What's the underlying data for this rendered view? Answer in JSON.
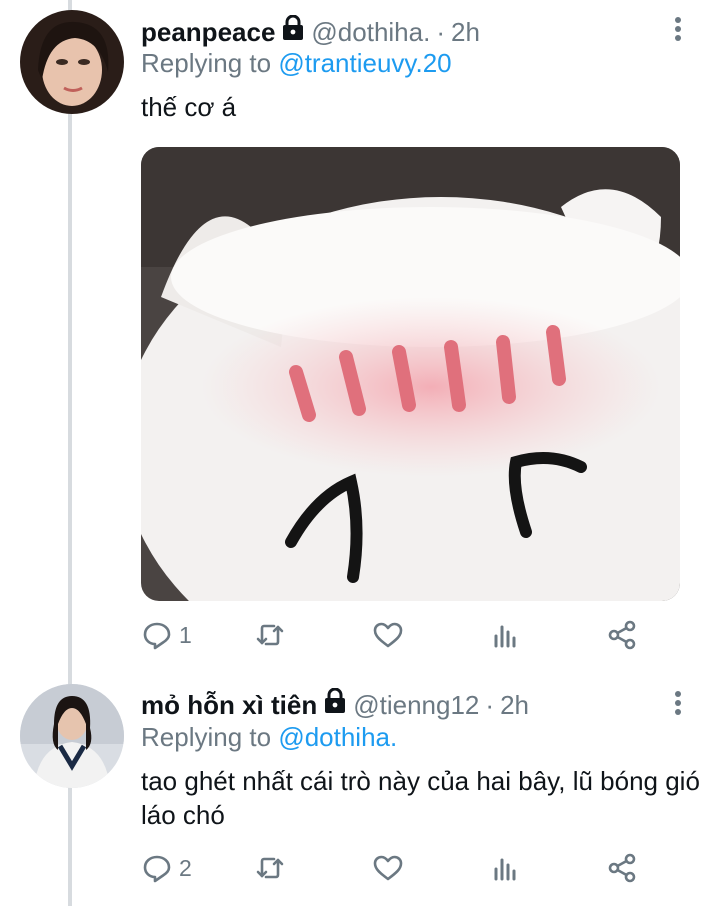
{
  "tweets": [
    {
      "display_name": "peanpeace",
      "handle": "@dothiha.",
      "separator": "·",
      "time": "2h",
      "replying_prefix": "Replying to",
      "replying_to": "@trantieuvy.20",
      "text": "thế cơ á",
      "reply_count": "1",
      "has_media": true,
      "media_icon": "blushing-white-cat-image"
    },
    {
      "display_name": "mỏ hỗn xì tiên",
      "handle": "@tienng12",
      "separator": "·",
      "time": "2h",
      "replying_prefix": "Replying to",
      "replying_to": "@dothiha.",
      "text": "tao ghét nhất cái trò này của hai bây, lũ bóng gió láo chó",
      "reply_count": "2",
      "has_media": false
    }
  ],
  "colors": {
    "link": "#1d9bf0",
    "muted": "#6b7882",
    "text": "#0f1419",
    "thread_line": "#d7dbdf"
  },
  "icons": [
    "reply-icon",
    "retweet-icon",
    "like-icon",
    "analytics-icon",
    "share-icon",
    "lock-icon",
    "more-icon"
  ]
}
